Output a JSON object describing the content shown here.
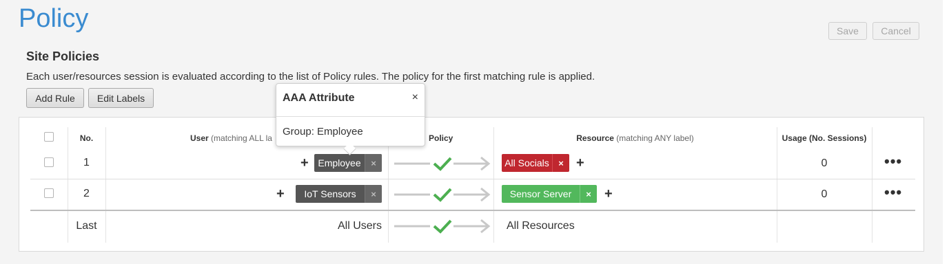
{
  "page": {
    "title": "Policy"
  },
  "top_actions": {
    "save": "Save",
    "cancel": "Cancel"
  },
  "section": {
    "title": "Site Policies",
    "description": "Each user/resources session is evaluated according to the list of Policy rules. The policy for the first matching rule is applied.",
    "add_rule": "Add Rule",
    "edit_labels": "Edit Labels"
  },
  "table": {
    "headers": {
      "no": "No.",
      "user": "User",
      "user_sub": "(matching ALL la",
      "policy": "Policy",
      "resource": "Resource",
      "resource_sub": "(matching ANY label)",
      "usage": "Usage (No. Sessions)"
    },
    "rows": [
      {
        "no": "1",
        "user_label": "Employee",
        "resource_label": "All Socials",
        "resource_color": "#c0272f",
        "usage": "0",
        "menu": "•••"
      },
      {
        "no": "2",
        "user_label": "IoT Sensors",
        "resource_label": "Sensor Server",
        "resource_color": "#52b85c",
        "usage": "0",
        "menu": "•••"
      }
    ],
    "last_row": {
      "no": "Last",
      "user": "All Users",
      "resource": "All Resources"
    },
    "plus": "+",
    "remove": "×"
  },
  "popup": {
    "title": "AAA Attribute",
    "close": "×",
    "body": "Group: Employee"
  },
  "colors": {
    "accent": "#3a8bd0",
    "check_green": "#4caf50",
    "arrow_gray": "#c8c8c8"
  }
}
